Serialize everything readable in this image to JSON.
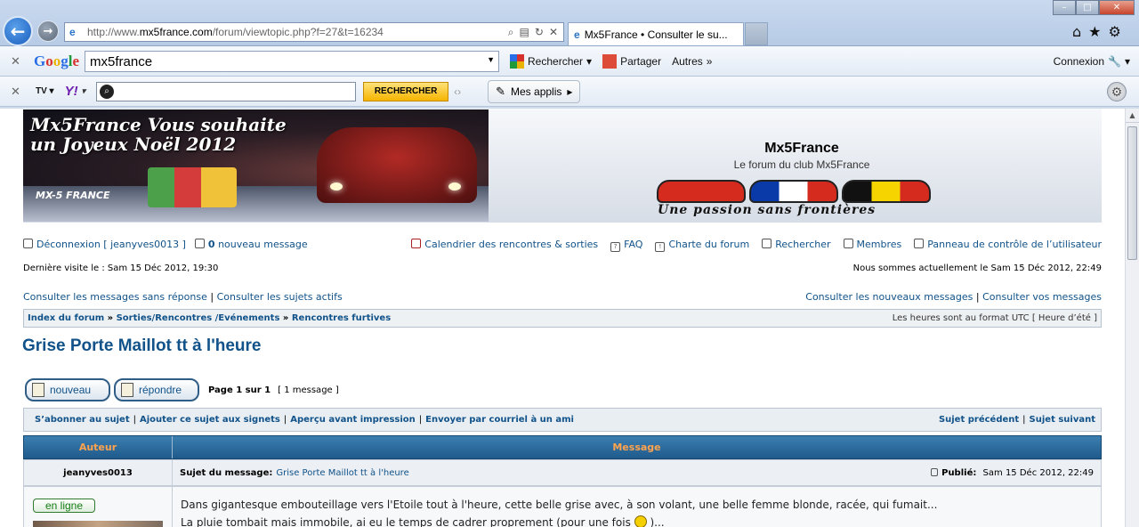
{
  "browser": {
    "url_prefix": "http://www.",
    "url_domain": "mx5france.com",
    "url_path": "/forum/viewtopic.php?f=27&t=16234",
    "tab_title": "Mx5France • Consulter le su...",
    "google_search_value": "mx5france",
    "google_search_label": "Rechercher",
    "google_share_label": "Partager",
    "google_more_label": "Autres",
    "google_connect_label": "Connexion",
    "yahoo_search_button": "RECHERCHER",
    "yahoo_apps_label": "Mes applis"
  },
  "header": {
    "banner_text": "Mx5France Vous souhaite un Joyeux Noël 2012",
    "site_name": "Mx5France",
    "site_description": "Le forum du club Mx5France",
    "slogan": "Une passion sans frontières"
  },
  "nav": {
    "logout": "Déconnexion [ jeanyves0013 ]",
    "new_messages_count": "0",
    "new_messages_label": "nouveau message",
    "calendar": "Calendrier des rencontres & sorties",
    "faq": "FAQ",
    "charter": "Charte du forum",
    "search": "Rechercher",
    "members": "Membres",
    "ucp": "Panneau de contrôle de l’utilisateur",
    "last_visit": "Dernière visite le : Sam 15 Déc 2012, 19:30",
    "now": "Nous sommes actuellement le Sam 15 Déc 2012, 22:49",
    "unanswered": "Consulter les messages sans réponse",
    "active": "Consulter les sujets actifs",
    "new_posts": "Consulter les nouveaux messages",
    "your_posts": "Consulter vos messages"
  },
  "breadcrumb": {
    "items": [
      "Index du forum",
      "Sorties/Rencontres /Evénements",
      "Rencontres furtives"
    ],
    "timezone": "Les heures sont au format UTC [ Heure d’été ]"
  },
  "topic": {
    "title": "Grise Porte Maillot tt à l'heure",
    "new_button": "nouveau",
    "reply_button": "répondre",
    "page_info": "Page 1 sur 1",
    "message_count": "[ 1 message ]"
  },
  "actions": {
    "subscribe": "S’abonner au sujet",
    "bookmark": "Ajouter ce sujet aux signets",
    "print": "Aperçu avant impression",
    "email": "Envoyer par courriel à un ami",
    "prev": "Sujet précédent",
    "next": "Sujet suivant"
  },
  "table": {
    "col_author": "Auteur",
    "col_message": "Message"
  },
  "post": {
    "author": "jeanyves0013",
    "subject_label": "Sujet du message:",
    "subject": "Grise Porte Maillot tt à l'heure",
    "published_label": "Publié:",
    "published": "Sam 15 Déc 2012, 22:49",
    "online_badge": "en ligne",
    "line1": "Dans gigantesque embouteillage vers l'Etoile tout à l'heure, cette belle grise avec, à son volant, une belle femme blonde, racée, qui fumait...",
    "line2_a": "La pluie tombait mais immobile, ai eu le temps de cadrer proprement (pour une fois",
    "line2_b": ")..."
  }
}
